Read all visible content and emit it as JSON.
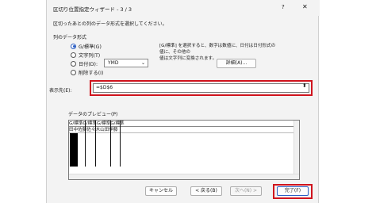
{
  "titlebar": {
    "title": "区切り位置指定ウィザード - 3 / 3",
    "help": "?",
    "close": "✕"
  },
  "description": "区切ったあとの列のデータ形式を選択してください。",
  "column_format": {
    "group_title": "列のデータ形式",
    "options": [
      {
        "label": "G/標準(G)",
        "checked": true
      },
      {
        "label": "文字列(T)",
        "checked": false
      },
      {
        "label": "日付(D):",
        "checked": false
      },
      {
        "label": "削除する(I)",
        "checked": false
      }
    ],
    "date_format": "YMD"
  },
  "info_text_1": "[G/標準] を選択すると、数字は数値に、日付は日付形式の値に、その他の",
  "info_text_2": "値は文字列に変換されます。",
  "detail_button": "詳細(A)...",
  "destination": {
    "label": "表示先(E):",
    "value": "=$D$6"
  },
  "preview": {
    "label": "データのプレビュー(P)",
    "header": "G/標準G/標準G/標準G/標準",
    "row1": "田中佐藤佐々木山田伊藤"
  },
  "footer": {
    "cancel": "キャンセル",
    "back": "< 戻る(B)",
    "next": "次へ(N) >",
    "finish": "完了(F)"
  }
}
